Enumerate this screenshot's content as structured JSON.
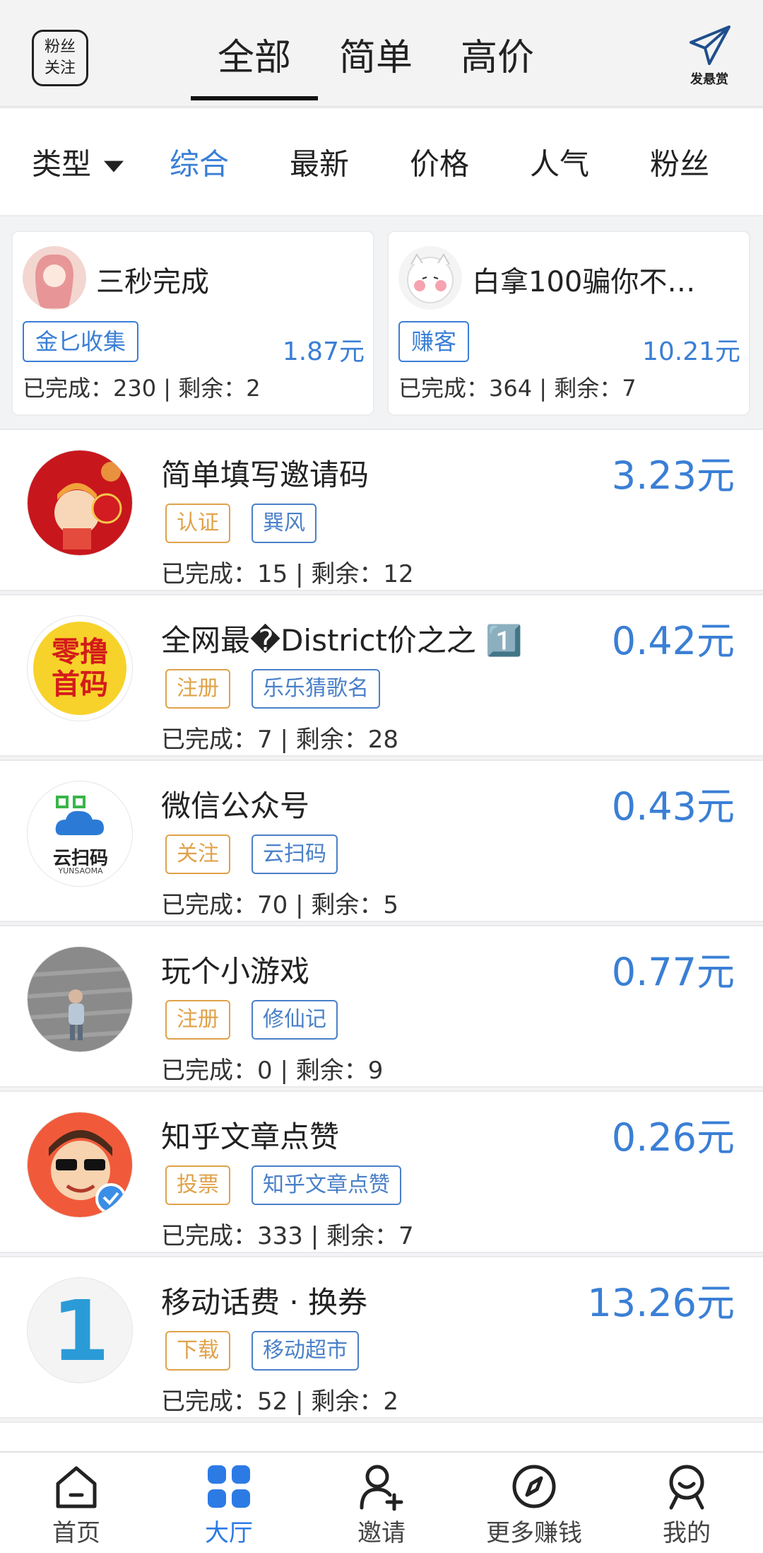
{
  "header": {
    "fans_button": {
      "line1": "粉丝",
      "line2": "关注"
    },
    "tabs": [
      {
        "label": "全部",
        "active": true
      },
      {
        "label": "简单"
      },
      {
        "label": "高价"
      }
    ],
    "reward_button": {
      "label": "发悬赏",
      "icon": "paper-plane-icon"
    }
  },
  "filters": {
    "type_label": "类型",
    "items": [
      {
        "label": "综合",
        "active": true
      },
      {
        "label": "最新"
      },
      {
        "label": "价格"
      },
      {
        "label": "人气"
      },
      {
        "label": "粉丝"
      }
    ]
  },
  "featured": [
    {
      "title": "三秒完成",
      "tag": "金匕收集",
      "price": "1.87元",
      "stats": "已完成：230 | 剩余：2"
    },
    {
      "title": "白拿100骗你不…",
      "tag": "赚客",
      "price": "10.21元",
      "stats": "已完成：364 | 剩余：7"
    }
  ],
  "tasks": [
    {
      "title": "简单填写邀请码",
      "price": "3.23元",
      "tag1": "认证",
      "tag2": "巽风",
      "stats": "已完成：15 | 剩余：12"
    },
    {
      "title": "全网最�District价之之 1️⃣",
      "price": "0.42元",
      "tag1": "注册",
      "tag2": "乐乐猜歌名",
      "stats": "已完成：7 | 剩余：28",
      "avatar_text": [
        "零撸",
        "首码"
      ]
    },
    {
      "title": "微信公众号",
      "price": "0.43元",
      "tag1": "关注",
      "tag2": "云扫码",
      "stats": "已完成：70 | 剩余：5",
      "avatar_text": [
        "云扫码",
        "YUNSAOMA"
      ]
    },
    {
      "title": "玩个小游戏",
      "price": "0.77元",
      "tag1": "注册",
      "tag2": "修仙记",
      "stats": "已完成：0 | 剩余：9"
    },
    {
      "title": "知乎文章点赞",
      "price": "0.26元",
      "tag1": "投票",
      "tag2": "知乎文章点赞",
      "stats": "已完成：333 | 剩余：7"
    },
    {
      "title": "移动话费 · 换券",
      "price": "13.26元",
      "tag1": "下载",
      "tag2": "移动超市",
      "stats": "已完成：52 | 剩余：2",
      "avatar_text": [
        "1"
      ]
    }
  ],
  "bottom_nav": [
    {
      "label": "首页",
      "icon": "home-icon"
    },
    {
      "label": "大厅",
      "icon": "grid-icon",
      "active": true
    },
    {
      "label": "邀请",
      "icon": "add-user-icon"
    },
    {
      "label": "更多赚钱",
      "icon": "compass-icon"
    },
    {
      "label": "我的",
      "icon": "profile-icon"
    }
  ],
  "colors": {
    "accent": "#3a7fd5",
    "tag_orange": "#e0a24a",
    "tag_blue": "#4a80c8",
    "nav_active": "#2c7be5"
  }
}
